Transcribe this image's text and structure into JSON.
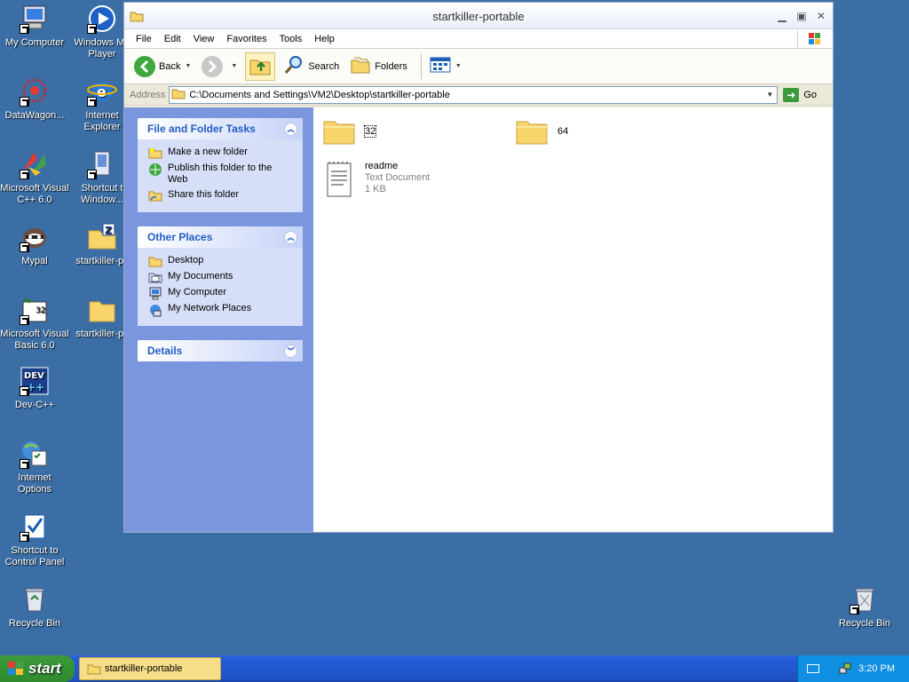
{
  "desktop": {
    "icons_left": [
      {
        "label": "My Computer",
        "icon": "my-computer-icon"
      },
      {
        "label": "DataWagon...",
        "icon": "datawagon-icon"
      },
      {
        "label": "Microsoft Visual\nC++ 6.0",
        "icon": "msvc-icon"
      },
      {
        "label": "Mypal",
        "icon": "mypal-icon"
      },
      {
        "label": "Microsoft Visual\nBasic 6.0",
        "icon": "vb6-icon"
      },
      {
        "label": "Dev-C++",
        "icon": "devcpp-icon"
      },
      {
        "label": "Internet\nOptions",
        "icon": "internet-options-icon"
      },
      {
        "label": "Shortcut to\nControl Panel",
        "icon": "control-panel-icon"
      },
      {
        "label": "Recycle Bin",
        "icon": "recycle-bin-icon"
      }
    ],
    "icons_right_col": [
      {
        "label": "Windows Me\nPlayer",
        "icon": "media-player-icon"
      },
      {
        "label": "Internet\nExplorer",
        "icon": "ie-icon"
      },
      {
        "label": "Shortcut t\nWindow...",
        "icon": "windows-shortcut-icon"
      },
      {
        "label": "startkiller-pc",
        "icon": "zip-folder-icon"
      },
      {
        "label": "startkiller-pc",
        "icon": "folder-icon"
      }
    ],
    "recycle_bin_right": {
      "label": "Recycle Bin"
    }
  },
  "window": {
    "title": "startkiller-portable",
    "menu": [
      "File",
      "Edit",
      "View",
      "Favorites",
      "Tools",
      "Help"
    ],
    "toolbar": {
      "back": "Back",
      "search": "Search",
      "folders": "Folders"
    },
    "address": {
      "label": "Address",
      "path": "C:\\Documents and Settings\\VM2\\Desktop\\startkiller-portable",
      "go": "Go"
    },
    "tasks": {
      "file_folder": {
        "title": "File and Folder Tasks",
        "items": [
          "Make a new folder",
          "Publish this folder to the Web",
          "Share this folder"
        ]
      },
      "other_places": {
        "title": "Other Places",
        "items": [
          "Desktop",
          "My Documents",
          "My Computer",
          "My Network Places"
        ]
      },
      "details": {
        "title": "Details"
      }
    },
    "files": [
      {
        "name": "32",
        "type": "folder"
      },
      {
        "name": "64",
        "type": "folder"
      },
      {
        "name": "readme",
        "type": "file",
        "kind": "Text Document",
        "size": "1 KB"
      }
    ]
  },
  "taskbar": {
    "start": "start",
    "task": "startkiller-portable",
    "time": "3:20 PM"
  },
  "colors": {
    "desktop": "#3a6ea5",
    "side_panel": "#7a96df",
    "taskbar": "#245edb",
    "start": "#2f8b2f"
  }
}
